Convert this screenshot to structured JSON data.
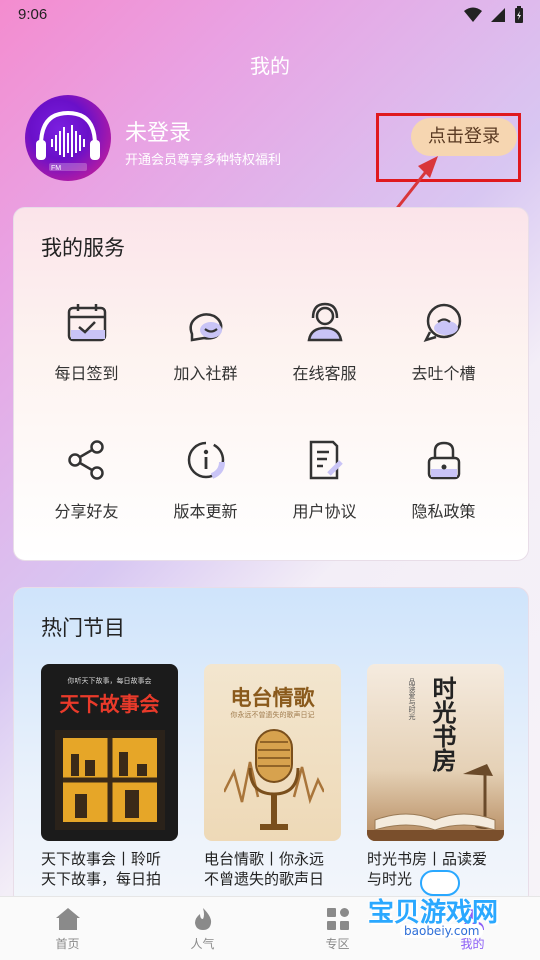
{
  "status_bar": {
    "time": "9:06"
  },
  "header": {
    "title": "我的"
  },
  "profile": {
    "avatar_tag": "FM",
    "login_status": "未登录",
    "vip_text": "开通会员尊享多种特权福利",
    "login_button": "点击登录"
  },
  "services": {
    "title": "我的服务",
    "items": [
      {
        "label": "每日签到",
        "icon": "calendar-check-icon"
      },
      {
        "label": "加入社群",
        "icon": "chat-bubbles-icon"
      },
      {
        "label": "在线客服",
        "icon": "headset-agent-icon"
      },
      {
        "label": "去吐个槽",
        "icon": "feedback-bubble-icon"
      },
      {
        "label": "分享好友",
        "icon": "share-icon"
      },
      {
        "label": "版本更新",
        "icon": "info-circle-icon"
      },
      {
        "label": "用户协议",
        "icon": "document-icon"
      },
      {
        "label": "隐私政策",
        "icon": "lock-icon"
      }
    ]
  },
  "hot": {
    "title": "热门节目",
    "programs": [
      {
        "cover_title": "天下故事会",
        "cover_tagline": "你听天下故事，每日故事会",
        "title_line1": "天下故事会丨聆听",
        "title_line2": "天下故事，每日拍"
      },
      {
        "cover_title": "电台情歌",
        "cover_tagline": "你永远不曾遗失的歌声日记",
        "title_line1": "电台情歌丨你永远",
        "title_line2": "不曾遗失的歌声日"
      },
      {
        "cover_title": "时光书房",
        "cover_tagline": "品读爱与时光",
        "title_line1": "时光书房丨品读爱",
        "title_line2": "与时光"
      }
    ]
  },
  "tabbar": {
    "tabs": [
      {
        "label": "首页",
        "icon": "home-icon"
      },
      {
        "label": "人气",
        "icon": "flame-icon"
      },
      {
        "label": "专区",
        "icon": "grid-icon"
      },
      {
        "label": "我的",
        "icon": "user-icon"
      }
    ],
    "active_index": 3
  },
  "watermark": {
    "text": "宝贝游戏网",
    "url": "baobeiy.com"
  },
  "colors": {
    "accent": "#8a5cf6",
    "login_button_bg": "#f6d6b1",
    "highlight": "#e0191e"
  }
}
